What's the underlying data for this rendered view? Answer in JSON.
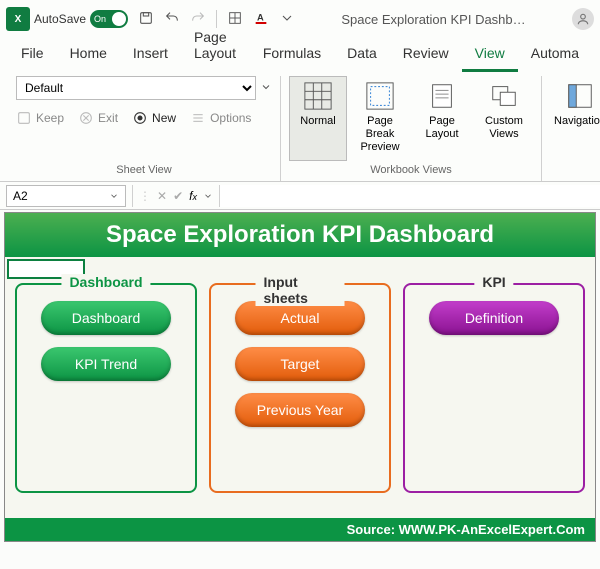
{
  "titlebar": {
    "autosave_label": "AutoSave",
    "autosave_toggle_text": "On",
    "doc_title": "Space Exploration KPI Dashb…"
  },
  "ribbon_tabs": [
    "File",
    "Home",
    "Insert",
    "Page Layout",
    "Formulas",
    "Data",
    "Review",
    "View",
    "Automa"
  ],
  "active_tab": "View",
  "sheet_view": {
    "select_value": "Default",
    "keep_label": "Keep",
    "exit_label": "Exit",
    "new_label": "New",
    "options_label": "Options",
    "group_label": "Sheet View"
  },
  "workbook_views": {
    "normal": "Normal",
    "page_break": "Page Break Preview",
    "page_layout": "Page Layout",
    "custom_views": "Custom Views",
    "navigation": "Navigation",
    "group_label": "Workbook Views"
  },
  "namebox": "A2",
  "dashboard": {
    "title": "Space Exploration KPI Dashboard",
    "groups": {
      "dashboard": {
        "legend": "Dashboard",
        "buttons": [
          "Dashboard",
          "KPI Trend"
        ]
      },
      "input": {
        "legend": "Input sheets",
        "buttons": [
          "Actual",
          "Target",
          "Previous Year"
        ]
      },
      "kpi": {
        "legend": "KPI",
        "buttons": [
          "Definition"
        ]
      }
    },
    "source": "Source: WWW.PK-AnExcelExpert.Com"
  }
}
